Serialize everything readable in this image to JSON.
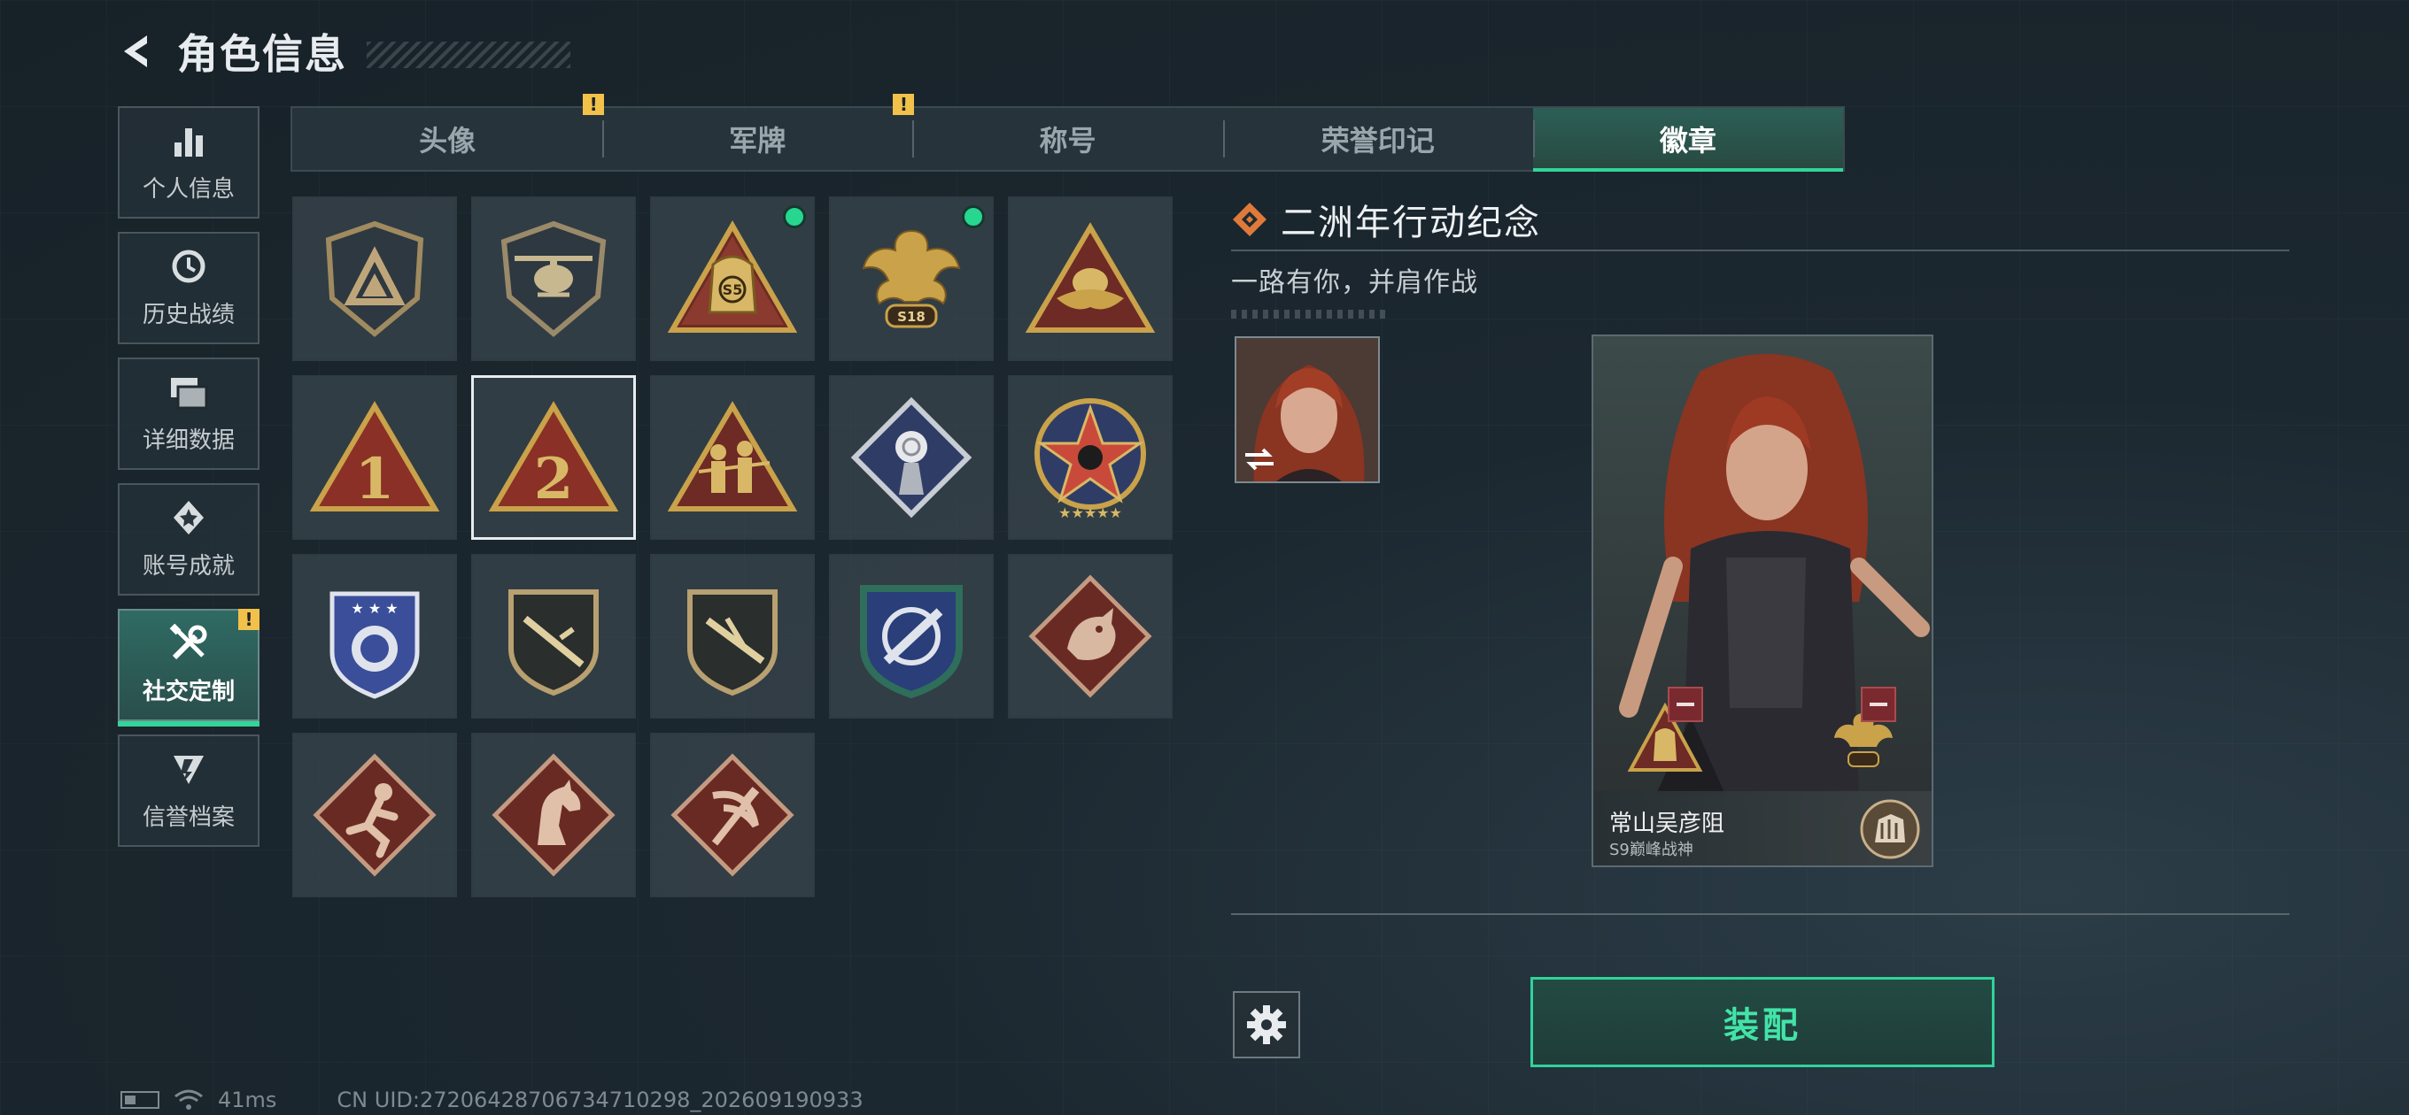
{
  "header": {
    "title": "角色信息"
  },
  "sidebar": {
    "items": [
      {
        "label": "个人信息",
        "icon": "bar-chart-icon"
      },
      {
        "label": "历史战绩",
        "icon": "history-clock-icon"
      },
      {
        "label": "详细数据",
        "icon": "folders-icon"
      },
      {
        "label": "账号成就",
        "icon": "achievement-icon"
      },
      {
        "label": "社交定制",
        "icon": "wrench-screwdriver-icon",
        "active": true,
        "alert": "!"
      },
      {
        "label": "信誉档案",
        "icon": "reputation-icon"
      }
    ]
  },
  "tabs": [
    {
      "label": "头像",
      "alert": "!"
    },
    {
      "label": "军牌",
      "alert": "!"
    },
    {
      "label": "称号"
    },
    {
      "label": "荣誉印记"
    },
    {
      "label": "徽章",
      "active": true
    }
  ],
  "badges": [
    {
      "name": "shield-triangle-badge",
      "color": "#8c7a5a",
      "new": false
    },
    {
      "name": "helicopter-badge",
      "color": "#8c7a5a",
      "new": false
    },
    {
      "name": "s5-bag-badge",
      "color": "#c9a24a",
      "text": "S5",
      "new": true
    },
    {
      "name": "s18-eagle-badge",
      "color": "#c9a24a",
      "text": "S18",
      "new": true
    },
    {
      "name": "egg-nest-badge",
      "color": "#c9a24a",
      "new": false
    },
    {
      "name": "number-1-badge",
      "color": "#c9a24a",
      "text": "1",
      "new": false
    },
    {
      "name": "number-2-badge",
      "color": "#c9a24a",
      "text": "2",
      "new": false,
      "selected": true
    },
    {
      "name": "soldiers-badge",
      "color": "#c9a24a",
      "new": false
    },
    {
      "name": "rose-badge",
      "color": "#5a6ea0",
      "new": false
    },
    {
      "name": "star-skull-badge",
      "color": "#c94a3a",
      "new": false
    },
    {
      "name": "blue-shield-badge",
      "color": "#3a4e9a",
      "new": false
    },
    {
      "name": "rifle-badge-1",
      "color": "#b8a070",
      "new": false
    },
    {
      "name": "rifle-badge-2",
      "color": "#b8a070",
      "new": false
    },
    {
      "name": "crosshair-knife-badge",
      "color": "#2e6e5a",
      "new": false
    },
    {
      "name": "dragon-badge",
      "color": "#8a3a32",
      "new": false
    },
    {
      "name": "runner-badge",
      "color": "#8a3a32",
      "new": false
    },
    {
      "name": "horse-badge",
      "color": "#8a3a32",
      "new": false
    },
    {
      "name": "hammer-sickle-badge",
      "color": "#8a3a32",
      "new": false
    }
  ],
  "detail": {
    "title": "二洲年行动纪念",
    "description": "一路有你，并肩作战",
    "card": {
      "name": "常山吴彦阻",
      "subtitle": "S9巅峰战神"
    }
  },
  "actions": {
    "equip_label": "装配"
  },
  "status": {
    "ping": "41ms",
    "uid": "CN UID:27206428706734710298_202609190933"
  },
  "colors": {
    "accent": "#33d49a",
    "alert": "#f2c14a"
  }
}
